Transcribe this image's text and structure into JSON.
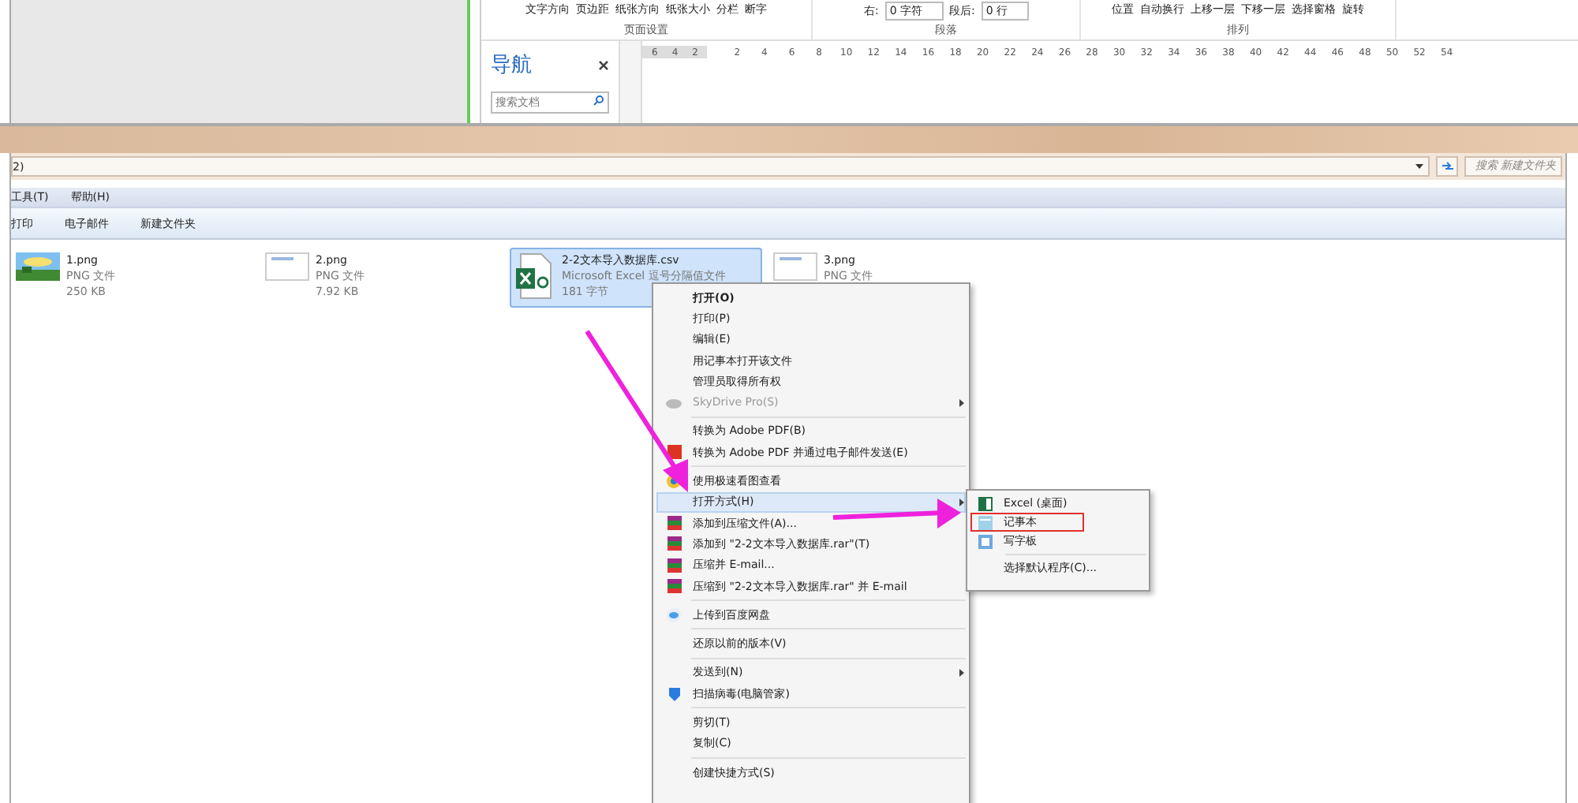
{
  "word_ribbon": {
    "top_labels": [
      "文字方向",
      "页边距",
      "纸张方向",
      "纸张大小",
      "分栏"
    ],
    "hyphenation": "断字",
    "page_setup_group": "页面设置",
    "indent_right_label": "右:",
    "indent_right_value": "0 字符",
    "space_after_label": "段后:",
    "space_after_value": "0 行",
    "paragraph_group": "段落",
    "arrange_top": [
      "位置",
      "自动换行",
      "上移一层",
      "下移一层",
      "选择窗格"
    ],
    "rotate": "旋转",
    "arrange_group": "排列"
  },
  "navigation": {
    "title": "导航",
    "search_placeholder": "搜索文档"
  },
  "ruler": {
    "left_ticks": [
      "6",
      "4",
      "2"
    ],
    "ticks": [
      "2",
      "4",
      "6",
      "8",
      "10",
      "12",
      "14",
      "16",
      "18",
      "20",
      "22",
      "24",
      "26",
      "28",
      "30",
      "32",
      "34",
      "36",
      "38",
      "40",
      "42",
      "44",
      "46",
      "48",
      "50",
      "52",
      "54"
    ]
  },
  "explorer": {
    "address": "2)",
    "search_placeholder": "搜索 新建文件夹",
    "menu": [
      "工具(T)",
      "帮助(H)"
    ],
    "commands": [
      "打印",
      "电子邮件",
      "新建文件夹"
    ],
    "files": [
      {
        "name": "1.png",
        "type": "PNG 文件",
        "size": "250 KB",
        "selected": false
      },
      {
        "kind": "doc",
        "name": "2.png",
        "type": "PNG 文件",
        "size": "7.92 KB",
        "selected": false
      },
      {
        "kind": "excel",
        "name": "2-2文本导入数据库.csv",
        "type": "Microsoft Excel 逗号分隔值文件",
        "size": "181 字节",
        "selected": true
      },
      {
        "kind": "doc",
        "name": "3.png",
        "type": "PNG 文件",
        "selected": false
      }
    ]
  },
  "context_menu": [
    {
      "kind": "plain",
      "label": "打开(O)",
      "bold": true,
      "disabled": false,
      "submenu": false,
      "highlighted": false
    },
    {
      "kind": "plain",
      "label": "打印(P)",
      "bold": false,
      "disabled": false,
      "submenu": false,
      "highlighted": false
    },
    {
      "kind": "plain",
      "label": "编辑(E)",
      "bold": false,
      "disabled": false,
      "submenu": false,
      "highlighted": false
    },
    {
      "kind": "plain",
      "label": "用记事本打开该文件",
      "bold": false,
      "disabled": false,
      "submenu": false,
      "highlighted": false
    },
    {
      "kind": "plain",
      "label": "管理员取得所有权",
      "bold": false,
      "disabled": false,
      "submenu": false,
      "highlighted": false
    },
    {
      "kind": "cloud",
      "label": "SkyDrive Pro(S)",
      "bold": false,
      "disabled": true,
      "submenu": true,
      "highlighted": false
    },
    {
      "kind": "separator"
    },
    {
      "kind": "plain",
      "label": "转换为 Adobe PDF(B)",
      "bold": false,
      "disabled": false,
      "submenu": false,
      "highlighted": false
    },
    {
      "kind": "pdf",
      "label": "转换为 Adobe PDF 并通过电子邮件发送(E)",
      "bold": false,
      "disabled": false,
      "submenu": false,
      "highlighted": false
    },
    {
      "kind": "separator"
    },
    {
      "kind": "viewer",
      "label": "使用极速看图查看",
      "bold": false,
      "disabled": false,
      "submenu": false,
      "highlighted": false
    },
    {
      "kind": "plain",
      "label": "打开方式(H)",
      "bold": false,
      "disabled": false,
      "submenu": true,
      "highlighted": true
    },
    {
      "kind": "archive",
      "label": "添加到压缩文件(A)...",
      "bold": false,
      "disabled": false,
      "submenu": false,
      "highlighted": false
    },
    {
      "kind": "archive",
      "label": "添加到 \"2-2文本导入数据库.rar\"(T)",
      "bold": false,
      "disabled": false,
      "submenu": false,
      "highlighted": false
    },
    {
      "kind": "archive",
      "label": "压缩并 E-mail...",
      "bold": false,
      "disabled": false,
      "submenu": false,
      "highlighted": false
    },
    {
      "kind": "archive",
      "label": "压缩到 \"2-2文本导入数据库.rar\" 并 E-mail",
      "bold": false,
      "disabled": false,
      "submenu": false,
      "highlighted": false
    },
    {
      "kind": "separator"
    },
    {
      "kind": "netdisk",
      "label": "上传到百度网盘",
      "bold": false,
      "disabled": false,
      "submenu": false,
      "highlighted": false
    },
    {
      "kind": "separator"
    },
    {
      "kind": "plain",
      "label": "还原以前的版本(V)",
      "bold": false,
      "disabled": false,
      "submenu": false,
      "highlighted": false
    },
    {
      "kind": "separator"
    },
    {
      "kind": "plain",
      "label": "发送到(N)",
      "bold": false,
      "disabled": false,
      "submenu": true,
      "highlighted": false
    },
    {
      "kind": "shield",
      "label": "扫描病毒(电脑管家)",
      "bold": false,
      "disabled": false,
      "submenu": false,
      "highlighted": false
    },
    {
      "kind": "separator"
    },
    {
      "kind": "plain",
      "label": "剪切(T)",
      "bold": false,
      "disabled": false,
      "submenu": false,
      "highlighted": false
    },
    {
      "kind": "plain",
      "label": "复制(C)",
      "bold": false,
      "disabled": false,
      "submenu": false,
      "highlighted": false
    },
    {
      "kind": "separator"
    },
    {
      "kind": "plain",
      "label": "创建快捷方式(S)",
      "bold": false,
      "disabled": false,
      "submenu": false,
      "highlighted": false
    }
  ],
  "open_with_submenu": [
    {
      "kind": "excel",
      "label": "Excel (桌面)",
      "boxed": false
    },
    {
      "kind": "notepad",
      "label": "记事本",
      "boxed": true
    },
    {
      "kind": "wordpad",
      "label": "写字板",
      "boxed": false
    },
    {
      "kind": "separator"
    },
    {
      "kind": "plain",
      "label": "选择默认程序(C)...",
      "boxed": false
    }
  ]
}
